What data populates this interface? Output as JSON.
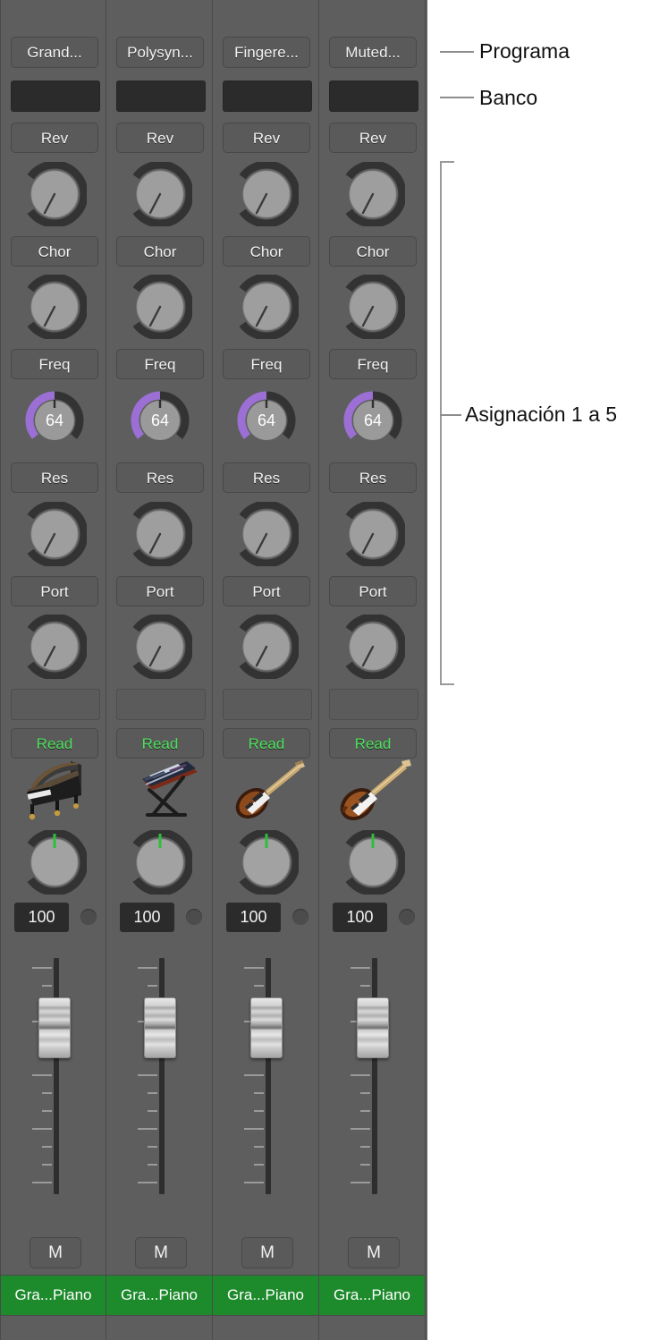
{
  "panel": {
    "background_color": "#5e5e5e",
    "divider_color": "#4a4a4a",
    "accent_purple": "#9b6fd4",
    "accent_green": "#4ce05a",
    "name_strip_color": "#1d8a2c"
  },
  "annotations": [
    {
      "id": "programa",
      "label": "Programa"
    },
    {
      "id": "banco",
      "label": "Banco"
    },
    {
      "id": "asignacion",
      "label": "Asignación 1 a 5"
    }
  ],
  "controls": {
    "send_labels": [
      "Rev",
      "Chor",
      "Freq",
      "Res",
      "Port"
    ],
    "automation_label": "Read",
    "mute_label": "M",
    "volume_value": "100",
    "resonance_value": "64",
    "bank_value": "",
    "blank_field_value": ""
  },
  "channels": [
    {
      "program": "Grand...",
      "bank": "",
      "send1_label": "Rev",
      "send2_label": "Chor",
      "send3_label": "Freq",
      "send4_label": "Res",
      "send5_label": "Port",
      "knob4_value": "64",
      "automation": "Read",
      "instrument_icon": "grand-piano-icon",
      "volume": "100",
      "mute": "M",
      "name": "Gra...Piano"
    },
    {
      "program": "Polysyn...",
      "bank": "",
      "send1_label": "Rev",
      "send2_label": "Chor",
      "send3_label": "Freq",
      "send4_label": "Res",
      "send5_label": "Port",
      "knob4_value": "64",
      "automation": "Read",
      "instrument_icon": "keyboard-stand-icon",
      "volume": "100",
      "mute": "M",
      "name": "Gra...Piano"
    },
    {
      "program": "Fingere...",
      "bank": "",
      "send1_label": "Rev",
      "send2_label": "Chor",
      "send3_label": "Freq",
      "send4_label": "Res",
      "send5_label": "Port",
      "knob4_value": "64",
      "automation": "Read",
      "instrument_icon": "bass-guitar-icon",
      "volume": "100",
      "mute": "M",
      "name": "Gra...Piano"
    },
    {
      "program": "Muted...",
      "bank": "",
      "send1_label": "Rev",
      "send2_label": "Chor",
      "send3_label": "Freq",
      "send4_label": "Res",
      "send5_label": "Port",
      "knob4_value": "64",
      "automation": "Read",
      "instrument_icon": "electric-guitar-icon",
      "volume": "100",
      "mute": "M",
      "name": "Gra...Piano"
    }
  ]
}
